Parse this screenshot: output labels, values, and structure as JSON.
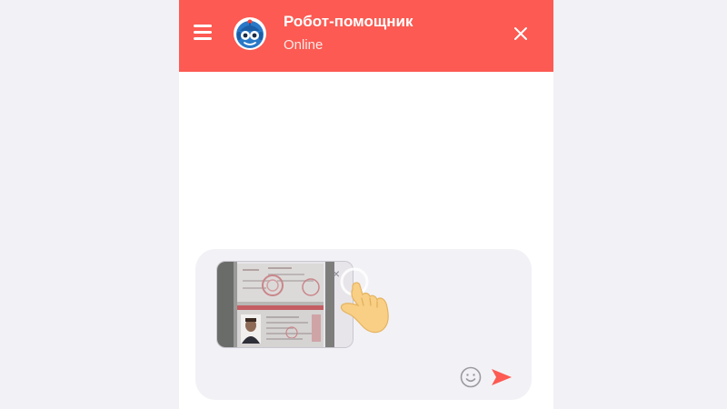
{
  "header": {
    "title": "Робот-помощник",
    "status": "Online"
  },
  "icons": {
    "menu": "hamburger-menu-icon",
    "avatar": "robot-avatar",
    "close": "close-icon",
    "remove": "remove-attachment-icon",
    "pointer": "tap-hand-icon",
    "emoji": "emoji-icon",
    "send": "send-icon"
  },
  "composer": {
    "attachment": {
      "type": "passport-photo",
      "remove_label": "×"
    }
  },
  "colors": {
    "accent": "#fc5a52",
    "page_background": "#f2f1f6",
    "composer_background": "#f2f1f6"
  }
}
